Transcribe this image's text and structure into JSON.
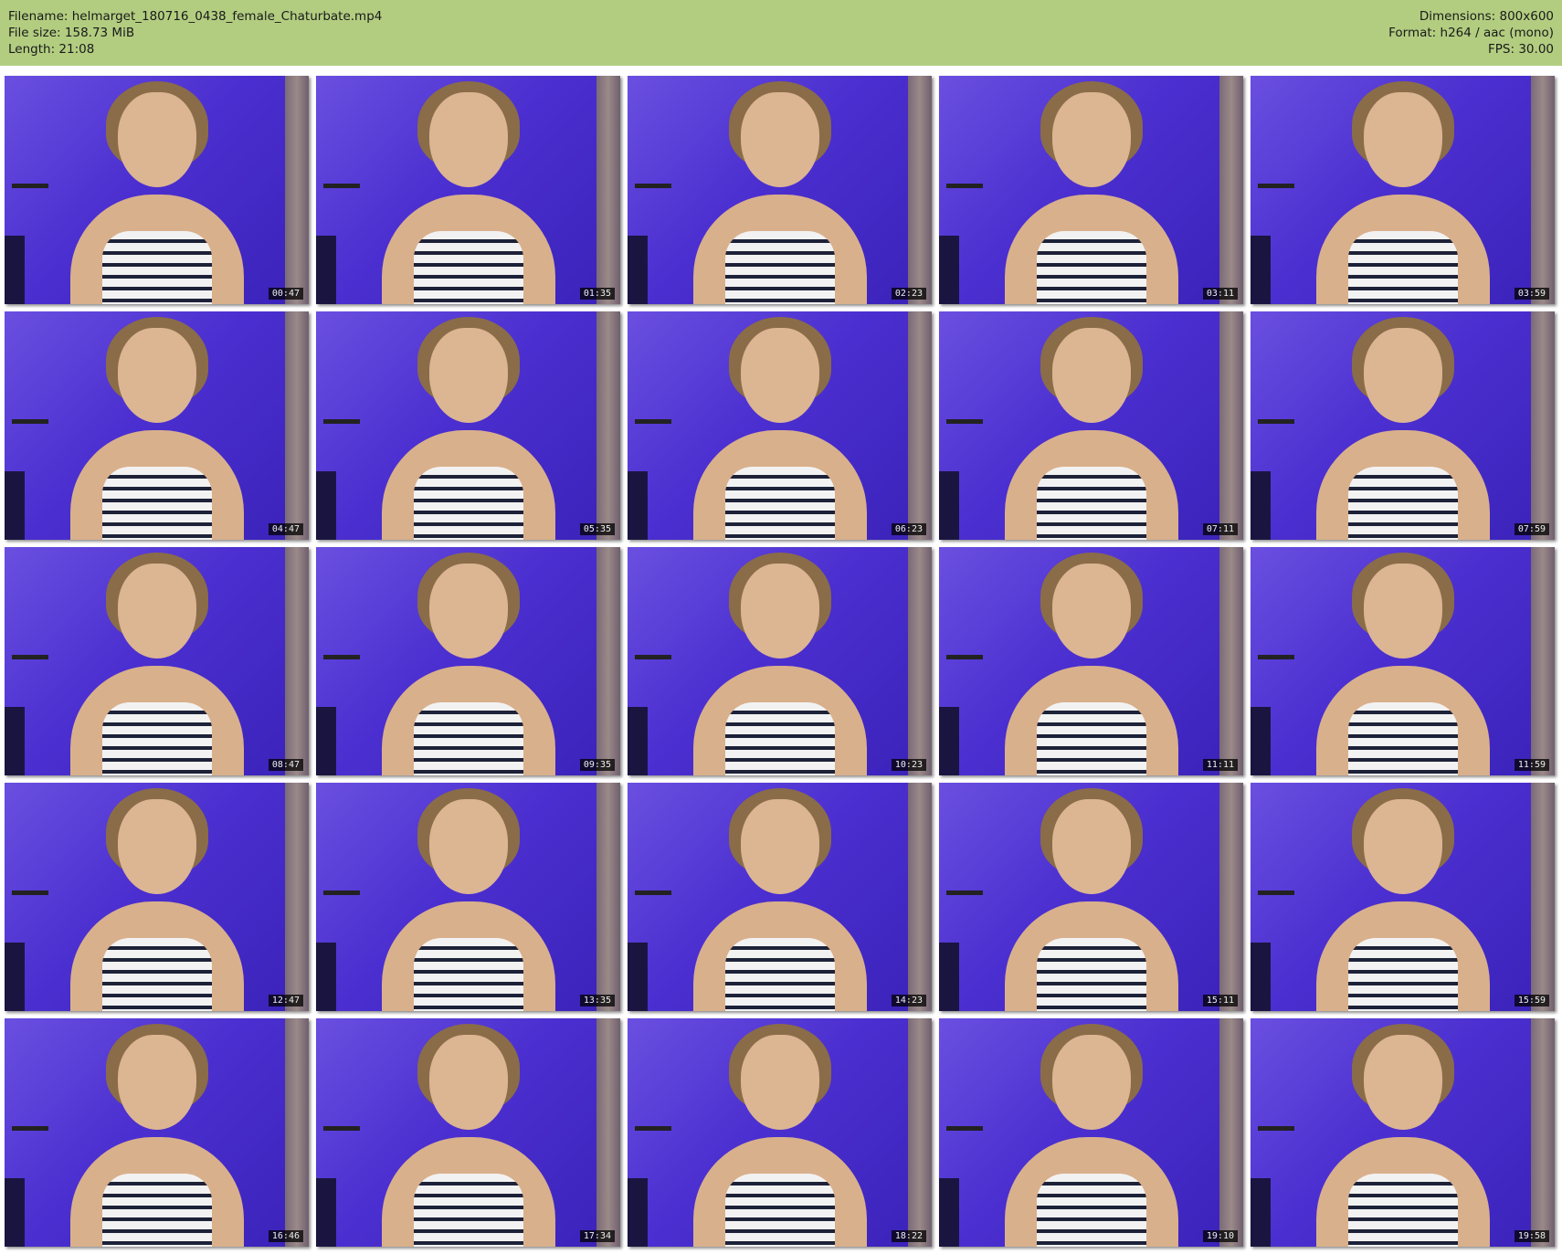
{
  "header": {
    "filename": "Filename: helmarget_180716_0438_female_Chaturbate.mp4",
    "filesize": "File size: 158.73 MiB",
    "length": "Length: 21:08",
    "dimensions": "Dimensions: 800x600",
    "format": "Format: h264 / aac (mono)",
    "fps": "FPS: 30.00"
  },
  "thumbnails": [
    "00:47",
    "01:35",
    "02:23",
    "03:11",
    "03:59",
    "04:47",
    "05:35",
    "06:23",
    "07:11",
    "07:59",
    "08:47",
    "09:35",
    "10:23",
    "11:11",
    "11:59",
    "12:47",
    "13:35",
    "14:23",
    "15:11",
    "15:59",
    "16:46",
    "17:34",
    "18:22",
    "19:10",
    "19:58"
  ]
}
